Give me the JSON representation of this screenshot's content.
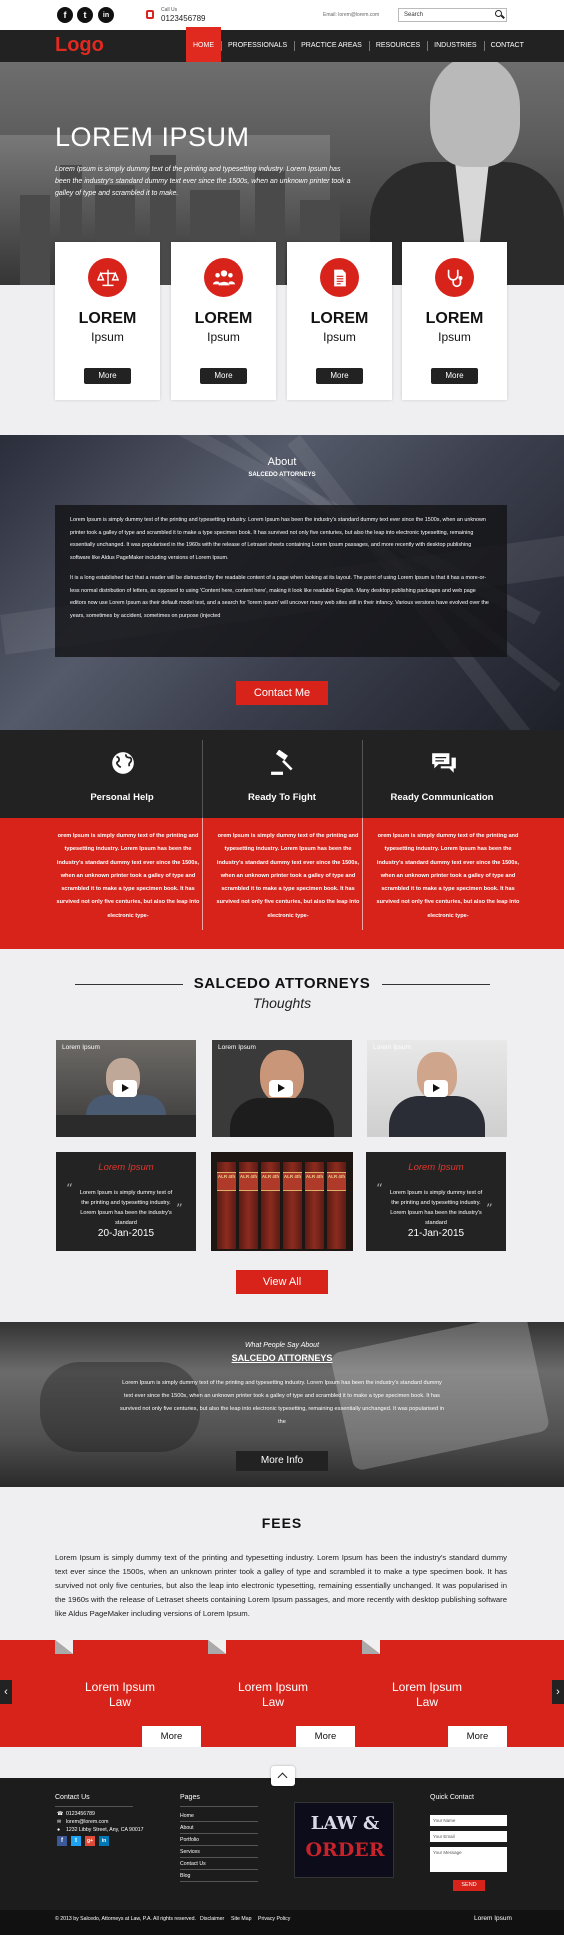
{
  "topbar": {
    "social": [
      "f",
      "t",
      "in"
    ],
    "call_label": "Call Us",
    "phone": "0123456789",
    "email": "Email: lorem@lorem.com",
    "search_placeholder": "Search"
  },
  "nav": {
    "logo": "Logo",
    "items": [
      "HOME",
      "PROFESSIONALS",
      "PRACTICE AREAS",
      "RESOURCES",
      "INDUSTRIES",
      "CONTACT"
    ]
  },
  "hero": {
    "title": "LOREM IPSUM",
    "text": "Lorem Ipsum is simply dummy text of the printing and typesetting industry. Lorem Ipsum has been the industry's standard dummy text ever since the 1500s, when an unknown printer took a galley of type and scrambled it to make."
  },
  "services": [
    {
      "title": "LOREM",
      "sub": "Ipsum",
      "button": "More",
      "icon": "scales-icon"
    },
    {
      "title": "LOREM",
      "sub": "Ipsum",
      "button": "More",
      "icon": "people-icon"
    },
    {
      "title": "LOREM",
      "sub": "Ipsum",
      "button": "More",
      "icon": "document-icon"
    },
    {
      "title": "LOREM",
      "sub": "Ipsum",
      "button": "More",
      "icon": "stethoscope-icon"
    }
  ],
  "about": {
    "title": "About",
    "subtitle": "SALCEDO ATTORNEYS",
    "para1": "Lorem Ipsum is simply dummy text of the printing and typesetting industry. Lorem Ipsum has been the industry's standard dummy text ever since the 1500s, when an unknown printer took a galley of type and scrambled it to make a type specimen book. It has survived not only five centuries, but also the leap into electronic typesetting, remaining essentially unchanged. It was popularised in the 1960s with the release of Letraset sheets containing Lorem Ipsum passages, and more recently with desktop publishing software like Aldus PageMaker including versions of Lorem Ipsum.",
    "para2": "It is a long established fact that a reader will be distracted by the readable content of a page when looking at its layout. The point of using Lorem Ipsum is that it has a more-or-less normal distribution of letters, as opposed to using 'Content here, content here', making it look like readable English. Many desktop publishing packages and web page editors now use Lorem Ipsum as their default model text, and a search for 'lorem ipsum' will uncover many web sites still in their infancy. Various versions have evolved over the years, sometimes by accident, sometimes on purpose (injected",
    "button": "Contact Me"
  },
  "features": [
    {
      "title": "Personal Help",
      "icon": "globe-icon",
      "text": "orem Ipsum is simply dummy text of the printing and typesetting industry. Lorem Ipsum has been the industry's standard dummy text ever since the 1500s, when an unknown printer took a galley of type and scrambled it to make a type specimen book. It has survived not only five centuries, but also the leap into electronic type-"
    },
    {
      "title": "Ready To Fight",
      "icon": "gavel-icon",
      "text": "orem Ipsum is simply dummy text of the printing and typesetting industry. Lorem Ipsum has been the industry's standard dummy text ever since the 1500s, when an unknown printer took a galley of type and scrambled it to make a type specimen book. It has survived not only five centuries, but also the leap into electronic type-"
    },
    {
      "title": "Ready Communication",
      "icon": "chat-icon",
      "text": "orem Ipsum is simply dummy text of the printing and typesetting industry. Lorem Ipsum has been the industry's standard dummy text ever since the 1500s, when an unknown printer took a galley of type and scrambled it to make a type specimen book. It has survived not only five centuries, but also the leap into electronic type-"
    }
  ],
  "thoughts": {
    "title": "SALCEDO ATTORNEYS",
    "subtitle": "Thoughts",
    "videos": [
      "Lorem Ipsum",
      "Lorem Ipsum",
      "Lorem Ipsum"
    ],
    "quotes": [
      {
        "title": "Lorem Ipsum",
        "text": "Lorem Ipsum is simply dummy text of the printing and typesetting industry. Lorem Ipsum has been the industry's standard",
        "date": "20-Jan-2015"
      },
      {
        "title": "Lorem Ipsum",
        "text": "Lorem Ipsum is simply dummy text of the printing and typesetting industry. Lorem Ipsum has been the industry's standard",
        "date": "21-Jan-2015"
      }
    ],
    "book_labels": [
      "ALR 4th",
      "ALR 4th",
      "ALR 4th",
      "ALR 4th",
      "ALR 4th",
      "ALR 4th"
    ],
    "button": "View All"
  },
  "testimonial": {
    "pre": "What People Say About",
    "title": "SALCEDO ATTORNEYS",
    "text": "Lorem Ipsum is simply dummy text of the printing and typesetting industry. Lorem Ipsum has been the industry's standard dummy text ever since the 1500s, when an unknown printer took a galley of type and scrambled it to make a type specimen book. It has survived not only five centuries, but also the leap into electronic typesetting, remaining essentially unchanged. It was popularised in the",
    "button": "More Info"
  },
  "fees": {
    "title": "FEES",
    "text": "Lorem Ipsum is simply dummy text of the printing and typesetting industry. Lorem Ipsum has been the industry's standard dummy text ever since the 1500s, when an unknown printer took a galley of type and scrambled it to make a type specimen book. It has survived not only five centuries, but also the leap into electronic typesetting, remaining essentially unchanged. It was popularised in the 1960s with the release of Letraset sheets containing Lorem Ipsum passages, and more recently with desktop publishing software like Aldus PageMaker including versions of Lorem Ipsum.",
    "cards": [
      {
        "line1": "Lorem Ipsum",
        "line2": "Law",
        "button": "More"
      },
      {
        "line1": "Lorem Ipsum",
        "line2": "Law",
        "button": "More"
      },
      {
        "line1": "Lorem Ipsum",
        "line2": "Law",
        "button": "More"
      }
    ],
    "prev": "‹",
    "next": "›"
  },
  "footer": {
    "contact_title": "Contact Us",
    "contact_items": [
      "0123456789",
      "lorem@lorem.com",
      "1232 Libby Street, Any, CA 90017"
    ],
    "social": [
      "f",
      "t",
      "g+",
      "in"
    ],
    "pages_title": "Pages",
    "pages": [
      "Home",
      "About",
      "Portfolio",
      "Services",
      "Contact Us",
      "Blog"
    ],
    "law_line1": "LAW &",
    "law_line2": "ORDER",
    "quick_title": "Quick Contact",
    "name_placeholder": "Your Name",
    "email_placeholder": "Your Email",
    "message_placeholder": "Your Message",
    "send": "SEND",
    "copyright": "© 2013 by Salcedo, Attorneys at Law, P.A. All rights reserved.",
    "links": [
      "Disclaimer",
      "Site Map",
      "Privacy Policy"
    ],
    "brand": "Lorem Ipsum"
  },
  "colors": {
    "accent": "#d8231b",
    "dark": "#222222"
  }
}
